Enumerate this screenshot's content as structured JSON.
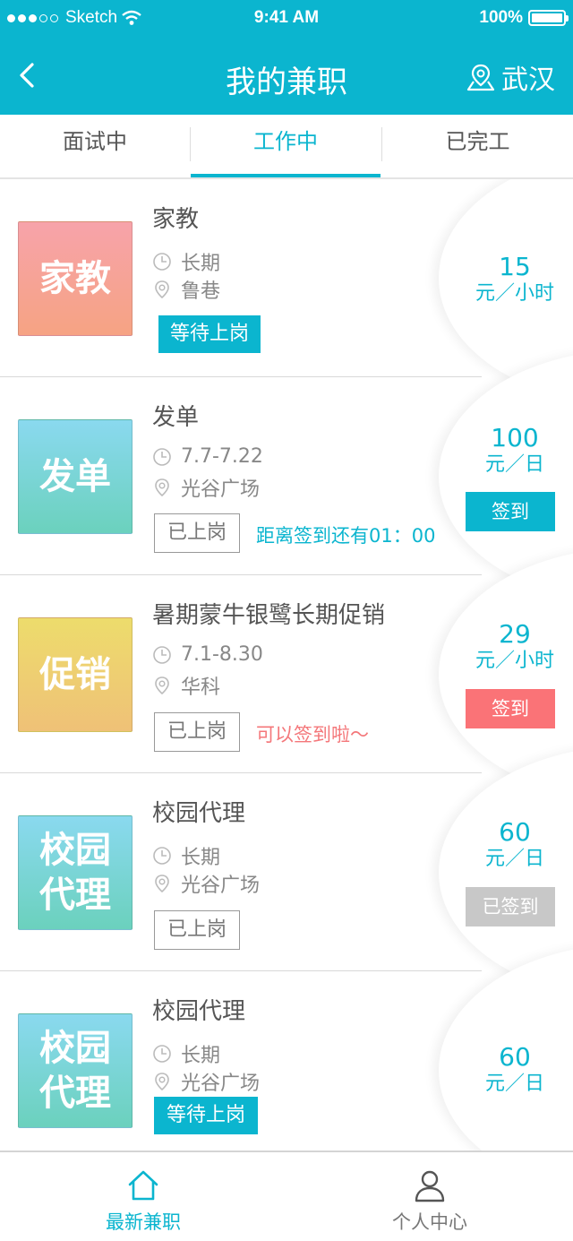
{
  "status_bar": {
    "carrier": "Sketch",
    "time": "9:41 AM",
    "battery": "100%"
  },
  "nav": {
    "title": "我的兼职",
    "city": "武汉"
  },
  "tabs": [
    {
      "label": "面试中"
    },
    {
      "label": "工作中"
    },
    {
      "label": "已完工"
    }
  ],
  "active_tab": 1,
  "jobs": [
    {
      "thumb": "家教",
      "title": "家教",
      "period": "长期",
      "location": "鲁巷",
      "status": "等待上岗",
      "status_type": "wait",
      "hint": "",
      "price": "15",
      "unit": "元／小时",
      "sign": ""
    },
    {
      "thumb": "发单",
      "title": "发单",
      "period": "7.7-7.22",
      "location": "光谷广场",
      "status": "已上岗",
      "status_type": "on",
      "hint": "距离签到还有01：00",
      "price": "100",
      "unit": "元／日",
      "sign": "签到"
    },
    {
      "thumb": "促销",
      "title": "暑期蒙牛银鹭长期促销",
      "period": "7.1-8.30",
      "location": "华科",
      "status": "已上岗",
      "status_type": "on",
      "hint": "可以签到啦～",
      "price": "29",
      "unit": "元／小时",
      "sign": "签到"
    },
    {
      "thumb": "校园代理",
      "title": "校园代理",
      "period": "长期",
      "location": "光谷广场",
      "status": "已上岗",
      "status_type": "on",
      "hint": "",
      "price": "60",
      "unit": "元／日",
      "sign": "已签到"
    },
    {
      "thumb": "校园代理",
      "title": "校园代理",
      "period": "长期",
      "location": "光谷广场",
      "status": "等待上岗",
      "status_type": "wait",
      "hint": "",
      "price": "60",
      "unit": "元／日",
      "sign": ""
    }
  ],
  "bottom_tabs": [
    {
      "label": "最新兼职",
      "icon": "home-icon"
    },
    {
      "label": "个人中心",
      "icon": "user-icon"
    }
  ],
  "colors": {
    "primary": "#0bb5cf",
    "sign_red": "#fa7377",
    "sign_done": "#c8c8c8",
    "hint_red": "#f4777a"
  }
}
